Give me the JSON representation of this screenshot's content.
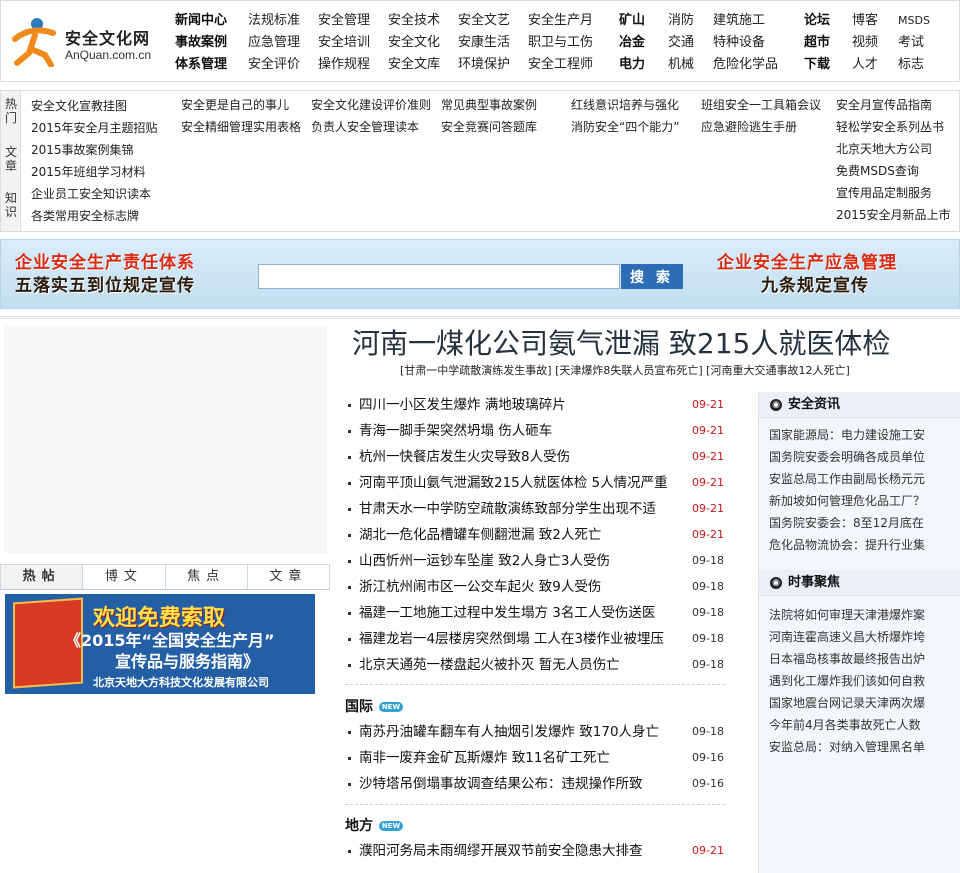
{
  "logo": {
    "title": "安全文化网",
    "subtitle": "AnQuan.com.cn"
  },
  "nav": {
    "row1": [
      "新闻中心",
      "法规标准",
      "安全管理",
      "安全技术",
      "安全文艺",
      "安全生产月",
      "矿山",
      "消防",
      "建筑施工",
      "论坛",
      "博客",
      "MSDS"
    ],
    "row2": [
      "事故案例",
      "应急管理",
      "安全培训",
      "安全文化",
      "安康生活",
      "职卫与工伤",
      "冶金",
      "交通",
      "特种设备",
      "超市",
      "视频",
      "考试"
    ],
    "row3": [
      "体系管理",
      "安全评价",
      "操作规程",
      "安全文库",
      "环境保护",
      "安全工程师",
      "电力",
      "机械",
      "危险化学品",
      "下载",
      "人才",
      "标志"
    ]
  },
  "hot": {
    "side_labels": [
      "热门",
      "文章",
      "知识"
    ],
    "col1": [
      "安全文化宣教挂图",
      "2015年安全月主题招贴",
      "2015事故案例集锦",
      "2015年班组学习材料",
      "企业员工安全知识读本",
      "各类常用安全标志牌"
    ],
    "r1": [
      "安全更是自己的事儿",
      "安全文化建设评价准则",
      "常见典型事故案例",
      "红线意识培养与强化",
      "班组安全一工具箱会议",
      "安全月宣传品指南"
    ],
    "r2": [
      "安全精细管理实用表格",
      "负责人安全管理读本",
      "安全竞赛问答题库",
      "消防安全“四个能力”",
      "应急避险逃生手册",
      "轻松学安全系列丛书"
    ],
    "col_right_rest": [
      "北京天地大方公司",
      "免费MSDS查询",
      "宣传用品定制服务",
      "2015安全月新品上市"
    ]
  },
  "banner": {
    "left1": "企业安全生产责任体系",
    "left2": "五落实五到位规定宣传",
    "right1": "企业安全生产应急管理",
    "right2": "九条规定宣传",
    "search_placeholder": "",
    "search_button": "搜 索"
  },
  "tabs": [
    "热帖",
    "博文",
    "焦点",
    "文章"
  ],
  "promo": {
    "title": "欢迎免费索取",
    "line1": "《2015年“全国安全生产月”",
    "line2": "宣传品与服务指南》",
    "company": "北京天地大方科技文化发展有限公司"
  },
  "headline": "河南一煤化公司氨气泄漏 致215人就医体检",
  "subheads": "[甘肃一中学疏散演练发生事故] [天津爆炸8失联人员宣布死亡] [河南重大交通事故12人死亡]",
  "news": [
    {
      "title": "四川一小区发生爆炸 满地玻璃碎片",
      "date": "09-21",
      "red": true
    },
    {
      "title": "青海一脚手架突然坍塌 伤人砸车",
      "date": "09-21",
      "red": true
    },
    {
      "title": "杭州一快餐店发生火灾导致8人受伤",
      "date": "09-21",
      "red": true
    },
    {
      "title": "河南平顶山氨气泄漏致215人就医体检 5人情况严重",
      "date": "09-21",
      "red": true
    },
    {
      "title": "甘肃天水一中学防空疏散演练致部分学生出现不适",
      "date": "09-21",
      "red": true
    },
    {
      "title": "湖北一危化品槽罐车侧翻泄漏 致2人死亡",
      "date": "09-21",
      "red": true
    },
    {
      "title": "山西忻州一运钞车坠崖 致2人身亡3人受伤",
      "date": "09-18",
      "red": false
    },
    {
      "title": "浙江杭州闹市区一公交车起火 致9人受伤",
      "date": "09-18",
      "red": false
    },
    {
      "title": "福建一工地施工过程中发生塌方 3名工人受伤送医",
      "date": "09-18",
      "red": false
    },
    {
      "title": "福建龙岩一4层楼房突然倒塌 工人在3楼作业被埋压",
      "date": "09-18",
      "red": false
    },
    {
      "title": "北京天通苑一楼盘起火被扑灭 暂无人员伤亡",
      "date": "09-18",
      "red": false
    }
  ],
  "intl": {
    "title": "国际",
    "badge": "NEW",
    "items": [
      {
        "title": "南苏丹油罐车翻车有人抽烟引发爆炸 致170人身亡",
        "date": "09-18",
        "red": false
      },
      {
        "title": "南非一废弃金矿瓦斯爆炸 致11名矿工死亡",
        "date": "09-16",
        "red": false
      },
      {
        "title": "沙特塔吊倒塌事故调查结果公布：违规操作所致",
        "date": "09-16",
        "red": false
      }
    ]
  },
  "local": {
    "title": "地方",
    "badge": "NEW",
    "items": [
      {
        "title": "濮阳河务局未雨绸缪开展双节前安全隐患大排查",
        "date": "09-21",
        "red": true
      }
    ]
  },
  "side": {
    "safety_title": "安全资讯",
    "safety": [
      "国家能源局：电力建设施工安",
      "国务院安委会明确各成员单位",
      "安监总局工作由副局长杨元元",
      "新加坡如何管理危化品工厂？",
      "国务院安委会：8至12月底在",
      "危化品物流协会：提升行业集"
    ],
    "focus_title": "时事聚焦",
    "focus": [
      "法院将如何审理天津港爆炸案",
      "河南连霍高速义昌大桥爆炸垮",
      "日本福岛核事故最终报告出炉",
      "遇到化工爆炸我们该如何自救",
      "国家地震台网记录天津两次爆",
      "今年前4月各类事故死亡人数",
      "安监总局：对纳入管理黑名单"
    ]
  }
}
